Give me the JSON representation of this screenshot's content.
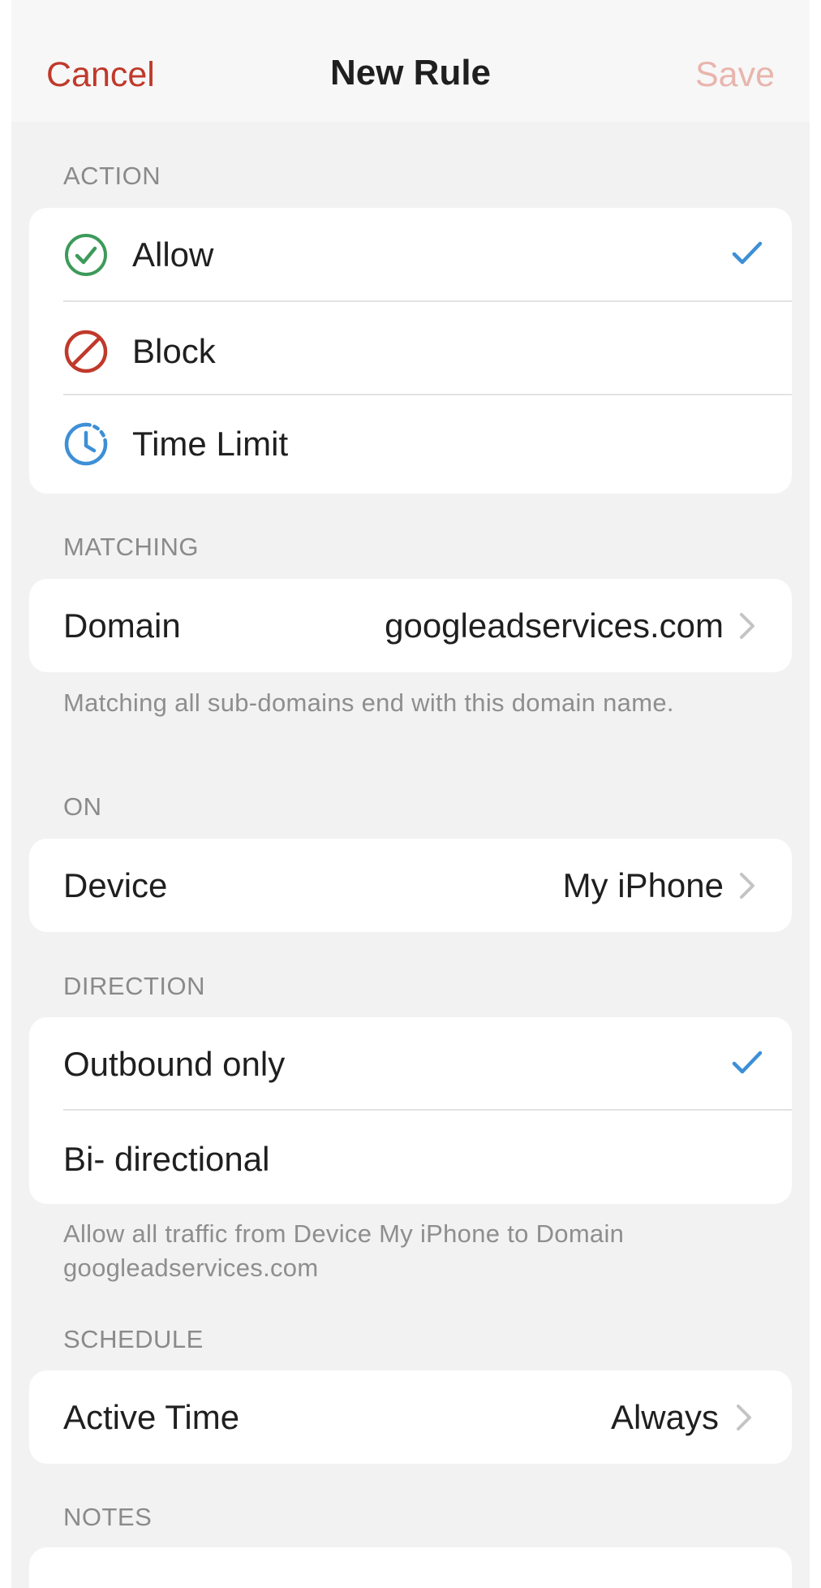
{
  "nav": {
    "cancel": "Cancel",
    "title": "New Rule",
    "save": "Save"
  },
  "action": {
    "header": "ACTION",
    "items": [
      {
        "label": "Allow",
        "icon": "check-circle-icon",
        "selected": true
      },
      {
        "label": "Block",
        "icon": "block-icon",
        "selected": false
      },
      {
        "label": "Time Limit",
        "icon": "time-limit-icon",
        "selected": false
      }
    ]
  },
  "matching": {
    "header": "MATCHING",
    "label": "Domain",
    "value": "googleadservices.com",
    "note": "Matching all sub-domains end with this domain name."
  },
  "on": {
    "header": "ON",
    "label": "Device",
    "value": "My iPhone"
  },
  "direction": {
    "header": "DIRECTION",
    "items": [
      {
        "label": "Outbound only",
        "selected": true
      },
      {
        "label": "Bi- directional",
        "selected": false
      }
    ],
    "note": "Allow all traffic from Device My iPhone to Domain googleadservices.com"
  },
  "schedule": {
    "header": "SCHEDULE",
    "label": "Active Time",
    "value": "Always"
  },
  "notes": {
    "header": "NOTES"
  },
  "colors": {
    "accent_red": "#c0392b",
    "save_disabled": "#e8b5ad",
    "allow_green": "#3d9a5a",
    "block_red": "#c0392b",
    "time_blue": "#3d8fd6",
    "check_blue": "#3d8fd6"
  }
}
